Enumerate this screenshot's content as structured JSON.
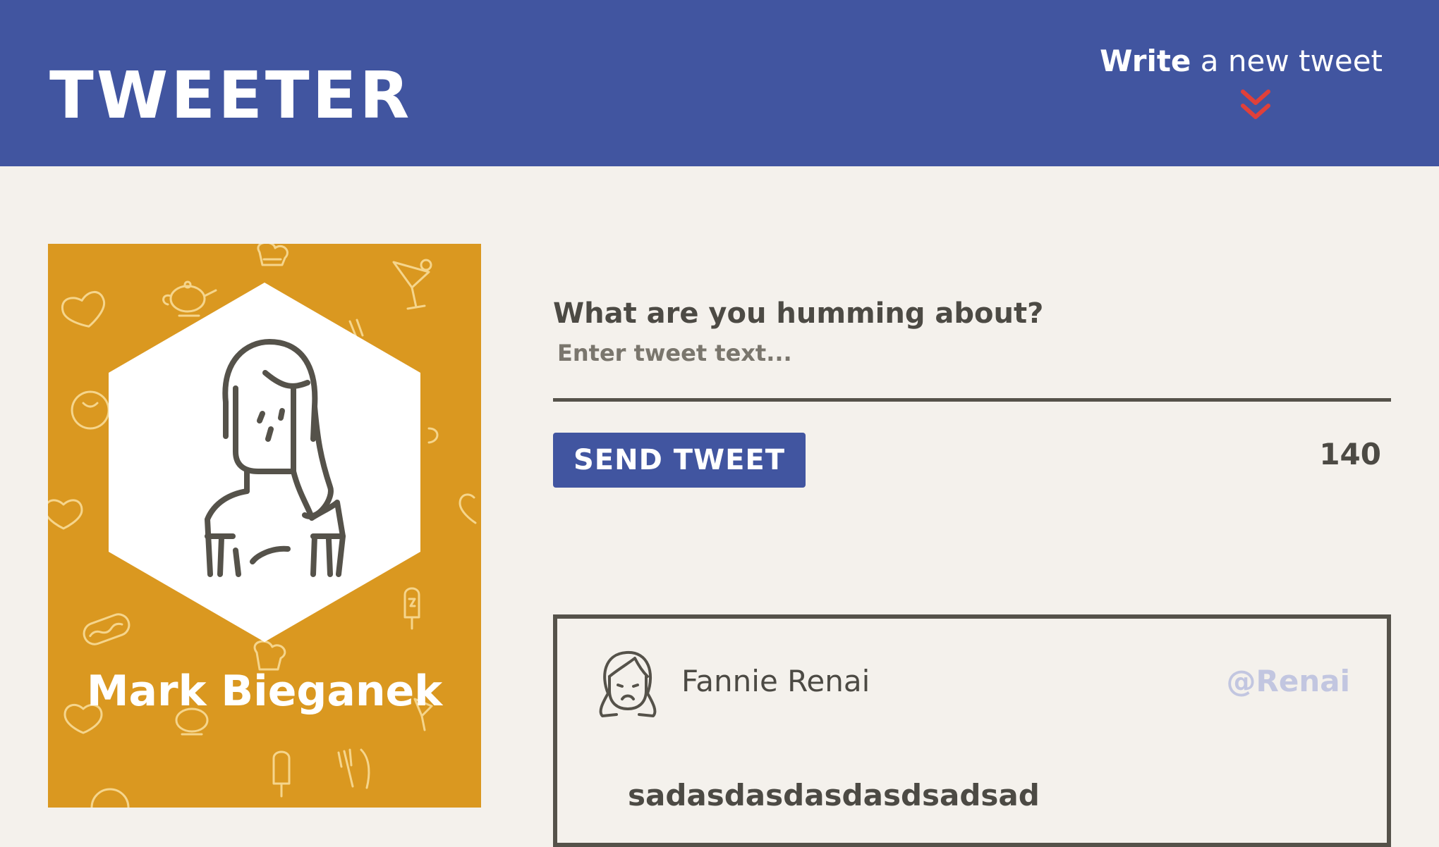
{
  "header": {
    "logo": "TWEETER",
    "write_toggle": {
      "strong": "Write",
      "rest": "a new tweet",
      "icon": "double-chevron-down-icon"
    }
  },
  "profile": {
    "name": "Mark Bieganek",
    "avatar_icon": "female-avatar-icon",
    "pattern_icons": [
      "heart-icon",
      "teapot-icon",
      "chef-hat-icon",
      "cocktail-icon",
      "smiley-icon",
      "popsicle-icon",
      "hotdog-icon",
      "cutlery-icon",
      "coffee-cup-icon"
    ]
  },
  "compose": {
    "label": "What are you humming about?",
    "placeholder": "Enter tweet text...",
    "value": "",
    "send_label": "SEND TWEET",
    "char_count": "140"
  },
  "tweets": [
    {
      "author": "Fannie Renai",
      "handle": "@Renai",
      "text": "sadasdasdasdasdsadsad",
      "avatar_icon": "sad-girl-avatar-icon"
    }
  ],
  "colors": {
    "header_bg": "#4155a0",
    "page_bg": "#f4f1ec",
    "card_bg": "#da9820",
    "chevron": "#e0403a",
    "handle": "#c2c6e0",
    "text_dark": "#4c4a44"
  }
}
